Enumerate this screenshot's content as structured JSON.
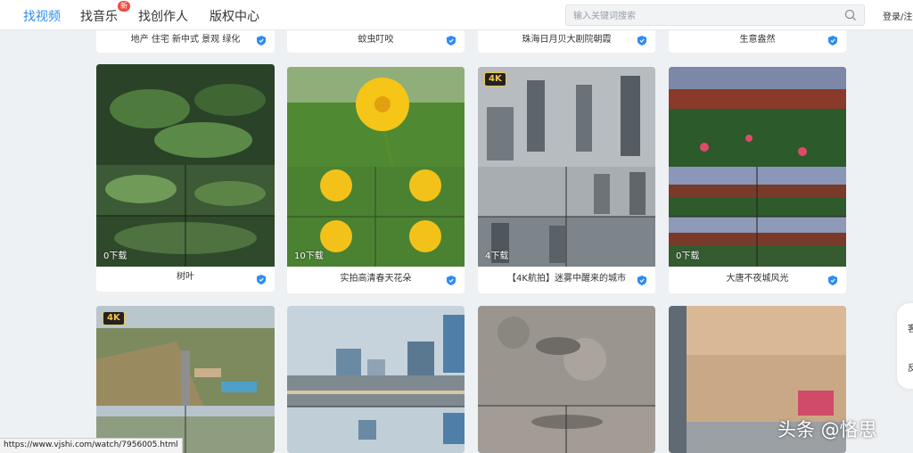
{
  "nav": {
    "items": [
      {
        "label": "找视频",
        "active": true
      },
      {
        "label": "找音乐",
        "badge": "新"
      },
      {
        "label": "找创作人"
      },
      {
        "label": "版权中心"
      }
    ],
    "search_placeholder": "输入关键词搜索",
    "login": "登录/注册"
  },
  "prev_row": [
    "地产 住宅 新中式 景观 绿化",
    "蚊虫叮咬",
    "珠海日月贝大剧院朝霞",
    "生意盎然"
  ],
  "row1": [
    {
      "title": "树叶",
      "count": "0下载",
      "tag": ""
    },
    {
      "title": "实拍高清春天花朵",
      "count": "10下载",
      "tag": ""
    },
    {
      "title": "【4K航拍】迷雾中醒来的城市",
      "count": "4下载",
      "tag": "4K"
    },
    {
      "title": "大唐不夜城风光",
      "count": "0下载",
      "tag": ""
    }
  ],
  "row2": [
    {
      "tag": "4K"
    },
    {
      "tag": ""
    },
    {
      "tag": ""
    },
    {
      "tag": ""
    }
  ],
  "side_float": [
    "客",
    "反"
  ],
  "status_url": "https://www.vjshi.com/watch/7956005.html",
  "watermark": "头条 @恪思",
  "colors": {
    "accent": "#2d8cf0",
    "badge": "#f04a3e",
    "tag_4k": "#f0c34a"
  }
}
